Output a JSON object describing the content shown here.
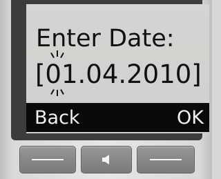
{
  "screen": {
    "title": "Enter Date:",
    "date_value": "[01.04.2010]"
  },
  "softkeys": {
    "left_label": "Back",
    "right_label": "OK"
  },
  "hardkeys": {
    "left_icon": "dash-icon",
    "middle_icon": "speaker-icon",
    "right_icon": "dash-icon"
  },
  "colors": {
    "display_background": "#d1d3d0",
    "softkey_bar": "#0a0a0a",
    "softkey_text": "#f2f2f2",
    "display_text": "#111111"
  }
}
